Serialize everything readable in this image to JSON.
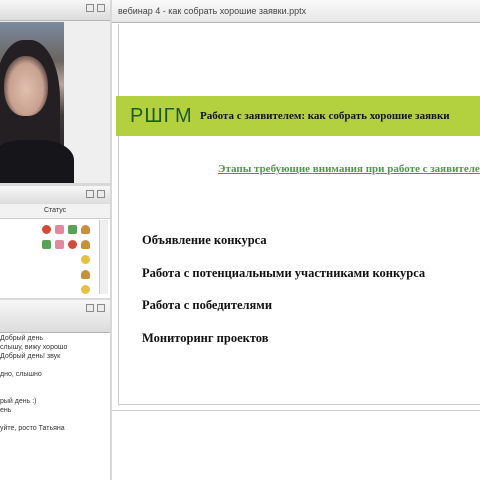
{
  "slide_window": {
    "title": "вебинар 4 - как собрать хорошие заявки.pptx"
  },
  "users": {
    "status_header": "Статус"
  },
  "chat": {
    "lines": [
      "Добрый день",
      "слышу, вижу хорошо",
      "Добрый день! звук",
      "",
      "дно, слышно",
      "",
      "",
      "рый день :)",
      "ень",
      "",
      "уйте, росто Татьяна"
    ]
  },
  "slide": {
    "logo": "РШГМ",
    "banner_title": "Работа с заявителем: как собрать  хорошие заявки",
    "subtitle": "Этапы требующие внимания при работе с заявителем",
    "items": [
      "Объявление конкурса",
      "Работа с потенциальными участниками конкурса",
      "Работа с победителями",
      "Мониторинг проектов"
    ],
    "colors": {
      "banner": "#b3d13f",
      "logo": "#1f5a22",
      "subtitle": "#4b9a4a"
    }
  }
}
